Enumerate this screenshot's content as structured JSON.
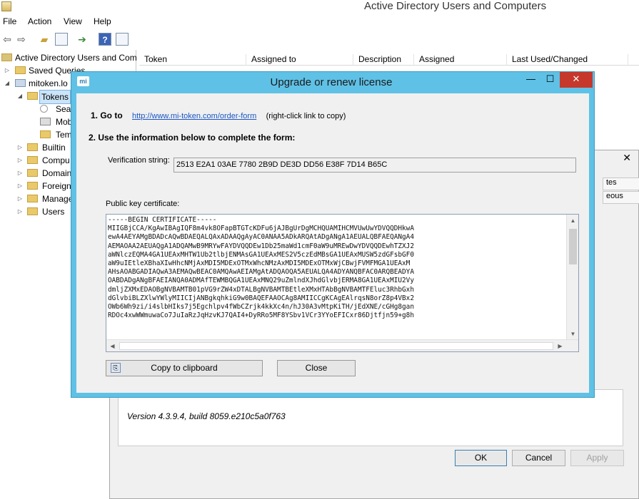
{
  "window": {
    "title": "Active Directory Users and Computers"
  },
  "menu": [
    "File",
    "Action",
    "View",
    "Help"
  ],
  "tree": {
    "root": "Active Directory Users and Com",
    "saved_queries": "Saved Queries",
    "domain": "mitoken.lo",
    "tokens": "Tokens",
    "search": "Sear",
    "mobile": "Mob",
    "templates": "Tem",
    "builtin": "Builtin",
    "computers": "Compu",
    "domain_controllers": "Domain",
    "foreign": "Foreign",
    "managed": "Manage",
    "users": "Users"
  },
  "list": {
    "columns": [
      "Token",
      "Assigned to",
      "Description",
      "Assigned",
      "Last Used/Changed"
    ]
  },
  "props_dialog": {
    "close": "✕",
    "tabs": [
      "tes",
      "eous"
    ],
    "version": "Version 4.3.9.4, build 8059.e210c5a0f763",
    "ok": "OK",
    "cancel": "Cancel",
    "apply": "Apply"
  },
  "license_dialog": {
    "title": "Upgrade or renew license",
    "icon_text": "mi",
    "step1_label": "1. Go to",
    "step1_url": "http://www.mi-token.com/order-form",
    "step1_hint": "(right-click link to copy)",
    "step2_label": "2. Use the information below to complete the form:",
    "verification_label": "Verification string:",
    "verification_value": "2513 E2A1 03AE 7780 2B9D DE3D DD56 E38F 7D14 B65C",
    "pubkey_label": "Public key certificate:",
    "certificate": "-----BEGIN CERTIFICATE-----\nMIIGBjCCA/KgAwIBAgIQF8m4vk8OFapBTGTcKDFu6jAJBgUrDgMCHQUAMIHCMVUwUwYDVQQDHkwA\newA4AEYAMgBDADcAQwBDAEQALQAxADAAQgAyAC0ANAA5ADkARQAtADgANgA1AEUALQBFAEQANgA4\nAEMAOAA2AEUAQgA1ADQAMwB9MRYwFAYDVQQDEw1Db25maWd1cmF0aW9uMREwDwYDVQQDEwhTZXJ2\naWNlczEQMA4GA1UEAxMHTW1Ub2tlbjENMAsGA1UEAxMES2V5czEdMBsGA1UEAxMUSW5zdGFsbGF0\naW9uIEtleXBhaXIwHhcNMjAxMDI5MDExOTMxWhcNMzAxMDI5MDExOTMxWjCBwjFVMFMGA1UEAxM\nAHsAOABGADIAQwA3AEMAQwBEAC0AMQAwAEIAMgAtADQAOQA5AEUALQA4ADYANQBFAC0ARQBEADYA\nOABDADgANgBFAEIANQA0ADMAfTEWMBQGA1UEAxMNQ29uZmlndXJhdGlvbjERMA8GA1UEAxMIU2Vy\ndmljZXMxEDAOBgNVBAMTB01pVG9rZW4xDTALBgNVBAMTBEtleXMxHTAbBgNVBAMTFEluc3RhbGxh\ndGlvbiBLZXlwYWlyMIICIjANBgkqhkiG9w0BAQEFAAOCAg8AMIICCgKCAgEAlrqsN8orZ8p4VBx2\nOWb6Wh9zi/i4slbHIks7j5Egchlpv4fWbCZrjk4kkXc4n/hJ30A3vMtpKiTH/jEdXNE/cGHg8gan\nRDOc4xwWWmuwaCo7JuIaRzJqHzvKJ7QAI4+DyRRo5MF8YSbv1VCr3YYoEFICxr86Djtfjn59+g8h",
    "copy_button": "Copy to clipboard",
    "close_button": "Close",
    "minimize": "—",
    "maximize": "☐",
    "close_x": "✕"
  },
  "colors": {
    "dialog_frame": "#5fc1e6",
    "close_button": "#c7382c",
    "link": "#1a55c4"
  }
}
